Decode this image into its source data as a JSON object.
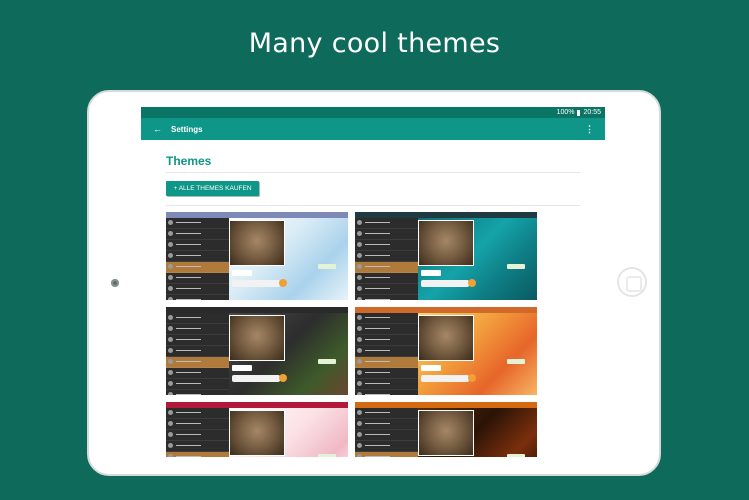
{
  "headline": "Many cool themes",
  "status_bar": {
    "battery": "100%",
    "time": "20:55"
  },
  "app_bar": {
    "back_icon": "arrow-back-icon",
    "title": "Settings",
    "menu_icon": "more-vert-icon"
  },
  "section": {
    "title": "Themes",
    "buy_button": "+ ALLE THEMES KAUFEN"
  },
  "colors": {
    "background": "#0e6b5c",
    "status_bar": "#0b7565",
    "app_bar": "#0e9688",
    "accent": "#0e9688"
  },
  "themes": [
    {
      "name": "watercolor-blue",
      "topbar": "#7d8ab8",
      "chat_bg": "linear-gradient(135deg,#ffffff 0%,#d9ecf5 40%,#a9d2ec 70%,#e7f3f8 100%)"
    },
    {
      "name": "teal-swirl",
      "topbar": "#1f3a40",
      "chat_bg": "linear-gradient(135deg,#0b6d74 0%,#14a3a8 45%,#0e7e85 70%,#0a5a60 100%)"
    },
    {
      "name": "dark-herbs",
      "topbar": "#2a2a2a",
      "chat_bg": "linear-gradient(135deg,#4a4a4a 0%,#2d2d2d 45%,#3e5a2a 75%,#6a4630 100%)"
    },
    {
      "name": "orange-watercolor",
      "topbar": "#d0692a",
      "chat_bg": "linear-gradient(135deg,#f7d66b 0%,#f29c3c 40%,#e7652a 70%,#f7b564 100%)"
    },
    {
      "name": "red-roses",
      "topbar": "#b3193a",
      "chat_bg": "linear-gradient(135deg,#ffffff 0%,#fbe1e6 45%,#f0b8c4 75%,#ffffff 100%)"
    },
    {
      "name": "orange-night",
      "topbar": "#d46a12",
      "chat_bg": "linear-gradient(135deg,#5a2a08 0%,#2a1306 40%,#7a2f0c 70%,#1e0d04 100%)"
    }
  ]
}
